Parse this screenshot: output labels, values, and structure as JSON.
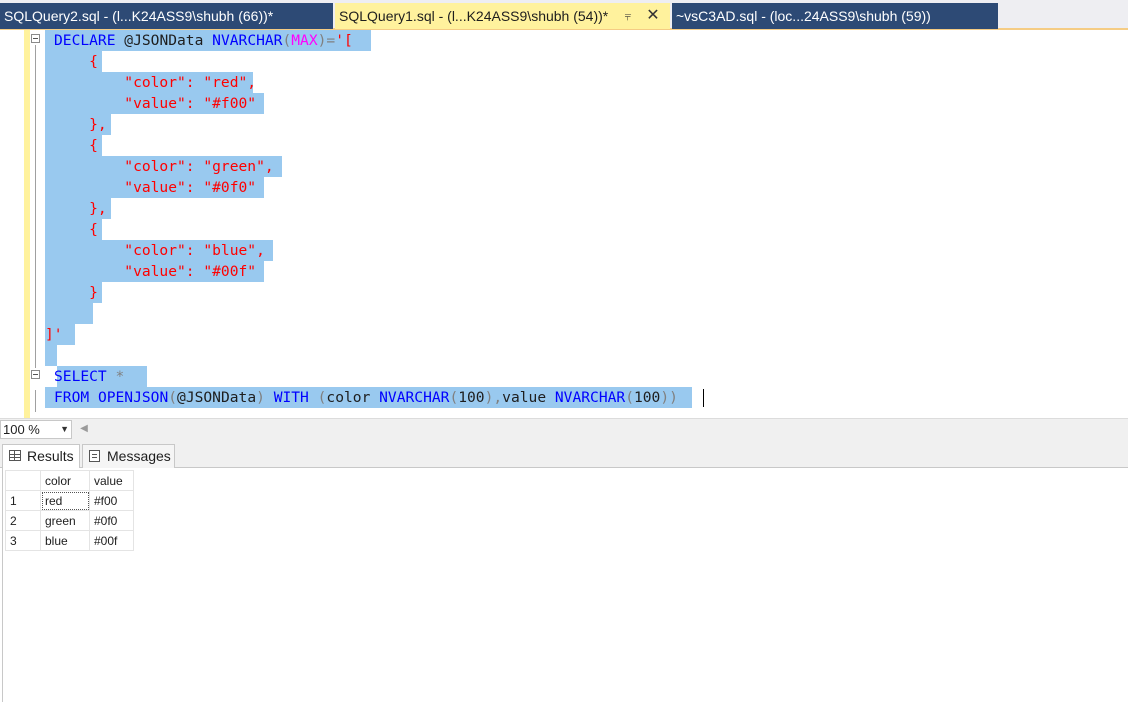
{
  "tabs": [
    {
      "label": "SQLQuery2.sql - (l...K24ASS9\\shubh (66))*",
      "active": false
    },
    {
      "label": "SQLQuery1.sql - (l...K24ASS9\\shubh (54))*",
      "active": true
    },
    {
      "label": "~vsC3AD.sql - (loc...24ASS9\\shubh (59))",
      "active": false
    }
  ],
  "editor": {
    "l1_declare": "DECLARE",
    "l1_var": " @JSONData ",
    "l1_type": "NVARCHAR",
    "l1_paren_open": "(",
    "l1_max": "MAX",
    "l1_paren_close": ")",
    "l1_eq": "=",
    "l1_str": "'[",
    "l2": "    {",
    "l3": "        \"color\": \"red\",",
    "l4": "        \"value\": \"#f00\"",
    "l5": "    },",
    "l6": "    {",
    "l7": "        \"color\": \"green\",",
    "l8": "        \"value\": \"#0f0\"",
    "l9": "    },",
    "l10": "    {",
    "l11": "        \"color\": \"blue\",",
    "l12": "        \"value\": \"#00f\"",
    "l13": "    }",
    "l15": "]'",
    "l17_select": "SELECT",
    "l17_star": " *",
    "l18_from": "FROM",
    "l18_openjson": " OPENJSON",
    "l18_p1": "(",
    "l18_var": "@JSONData",
    "l18_p2": ") ",
    "l18_with": "WITH",
    "l18_p3": " (",
    "l18_col1": "color ",
    "l18_type1": "NVARCHAR",
    "l18_p4": "(",
    "l18_n1": "100",
    "l18_p5": "),",
    "l18_col2": "value ",
    "l18_type2": "NVARCHAR",
    "l18_p6": "(",
    "l18_n2": "100",
    "l18_p7": "))"
  },
  "zoom": {
    "value": "100 %"
  },
  "result_tabs": {
    "results": "Results",
    "messages": "Messages"
  },
  "grid": {
    "columns": [
      "color",
      "value"
    ],
    "rows": [
      {
        "n": "1",
        "color": "red",
        "value": "#f00"
      },
      {
        "n": "2",
        "color": "green",
        "value": "#0f0"
      },
      {
        "n": "3",
        "color": "blue",
        "value": "#00f"
      }
    ]
  },
  "colors": {
    "tab_inactive": "#2d4a75",
    "tab_active": "#fff29d",
    "selection": "#99c9ef",
    "keyword": "#0000ff",
    "string": "#ff0000",
    "function": "#ff00ff",
    "operator": "#808080"
  },
  "icons": {
    "pin": "pin-icon",
    "close": "close-icon",
    "results": "grid-icon",
    "messages": "message-icon",
    "zoom_dropdown": "chevron-down-icon",
    "scroll_left": "scroll-left-icon"
  }
}
